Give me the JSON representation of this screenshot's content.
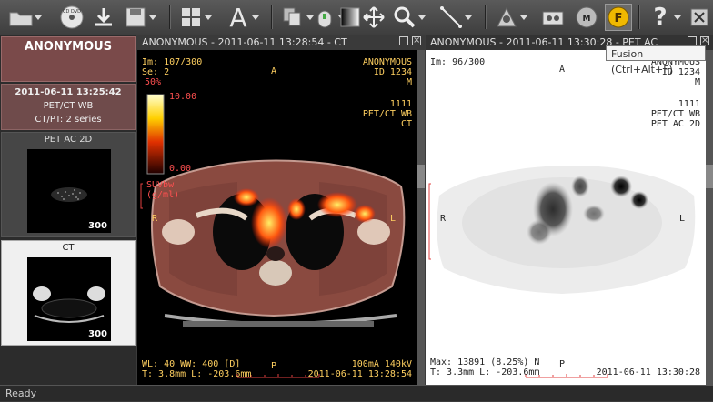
{
  "toolbar": {
    "icons": [
      "open-folder-icon",
      "cd-dvd-icon",
      "download-icon",
      "save-icon",
      "layout-grid-icon",
      "text-annotation-icon",
      "series-stack-icon",
      "mouse-tool-icon",
      "window-level-icon",
      "pan-icon",
      "zoom-icon",
      "measure-icon",
      "mpr-icon",
      "movie-icon",
      "mip-icon",
      "fusion-icon",
      "help-icon",
      "settings-icon"
    ],
    "cd_label": "CD DVD",
    "tooltip": "Fusion (Ctrl+Alt+F)"
  },
  "sidebar": {
    "patient_name": "ANONYMOUS",
    "study_date": "2011-06-11 13:25:42",
    "study_desc": "PET/CT WB",
    "study_info": "CT/PT: 2 series",
    "series": [
      {
        "label": "PET AC 2D",
        "count": "300"
      },
      {
        "label": "CT",
        "count": "300"
      }
    ]
  },
  "viewport1": {
    "title": "ANONYMOUS - 2011-06-11 13:28:54 - CT",
    "im": "Im: 107/300",
    "se": "Se: 2",
    "opacity": "50%",
    "scale_max": "10.00",
    "scale_min": "0.00",
    "units": "SUVbw",
    "units2": "(g/ml)",
    "orient_top": "A",
    "orient_bottom": "P",
    "orient_left": "R",
    "orient_right": "L",
    "patient": "ANONYMOUS",
    "id": "ID 1234",
    "sex": "M",
    "study_id": "1111",
    "study_desc": "PET/CT WB",
    "modality": "CT",
    "wl": "WL: 40 WW: 400 [D]",
    "thickness": "T: 3.8mm L: -203.6mm",
    "tube": "100mA 140kV",
    "datetime": "2011-06-11 13:28:54"
  },
  "viewport2": {
    "title": "ANONYMOUS - 2011-06-11 13:30:28 - PET AC",
    "im": "Im: 96/300",
    "orient_top": "A",
    "orient_bottom": "P",
    "orient_left": "R",
    "orient_right": "L",
    "patient": "ANONYMOUS",
    "id": "ID 1234",
    "sex": "M",
    "study_id": "1111",
    "study_desc": "PET/CT WB",
    "series_desc": "PET AC 2D",
    "max": "Max: 13891 (8.25%) N",
    "thickness": "T: 3.3mm L: -203.6mm",
    "datetime": "2011-06-11 13:30:28"
  },
  "status": "Ready"
}
